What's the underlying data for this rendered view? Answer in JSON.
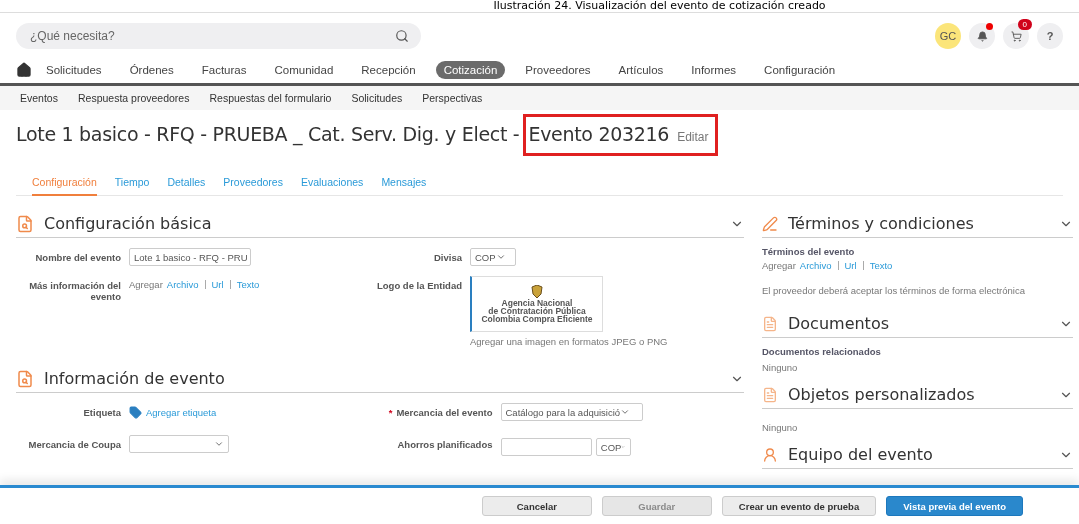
{
  "caption": "Ilustración 24. Visualización del evento de cotización creado",
  "search": {
    "placeholder": "¿Qué necesita?"
  },
  "header": {
    "avatar": "GC",
    "notifications_unread": true,
    "cart_count": "0",
    "help": "?"
  },
  "nav": [
    {
      "label": "Solicitudes",
      "selected": false
    },
    {
      "label": "Órdenes",
      "selected": false
    },
    {
      "label": "Facturas",
      "selected": false
    },
    {
      "label": "Comunidad",
      "selected": false
    },
    {
      "label": "Recepción",
      "selected": false
    },
    {
      "label": "Cotización",
      "selected": true
    },
    {
      "label": "Proveedores",
      "selected": false
    },
    {
      "label": "Artículos",
      "selected": false
    },
    {
      "label": "Informes",
      "selected": false
    },
    {
      "label": "Configuración",
      "selected": false
    }
  ],
  "subnav": [
    "Eventos",
    "Respuesta proveedores",
    "Respuestas del formulario",
    "Solicitudes",
    "Perspectivas"
  ],
  "title": {
    "text": "Lote 1 basico - RFQ - PRUEBA _ Cat. Serv. Dig. y Elect -",
    "highlighted": "Evento 203216",
    "action": "Editar"
  },
  "tabs": [
    {
      "label": "Configuración",
      "selected": true
    },
    {
      "label": "Tiempo",
      "selected": false
    },
    {
      "label": "Detalles",
      "selected": false
    },
    {
      "label": "Proveedores",
      "selected": false
    },
    {
      "label": "Evaluaciones",
      "selected": false
    },
    {
      "label": "Mensajes",
      "selected": false
    }
  ],
  "basic_config": {
    "title": "Configuración básica",
    "event_name_label": "Nombre del evento",
    "event_name_value": "Lote 1 basico - RFQ - PRU",
    "more_info_label": "Más información del evento",
    "add": "Agregar",
    "links": [
      "Archivo",
      "Url",
      "Texto"
    ],
    "currency_label": "Divisa",
    "currency": "COP",
    "logo_label": "Logo de la Entidad",
    "logo_lines": [
      "Agencia Nacional",
      "de Contratación Pública",
      "Colombia Compra Eficiente"
    ],
    "logo_hint": "Agregar una imagen en formatos JPEG o PNG"
  },
  "event_info": {
    "title": "Información de evento",
    "tag_label": "Etiqueta",
    "tag_action": "Agregar etiqueta",
    "commodity_label": "Mercancia del evento",
    "required_mark": "*",
    "commodity_value": "Catálogo para la adquisició",
    "coupa_label": "Mercancia de Coupa",
    "savings_label": "Ahorros planificados",
    "savings_currency": "COP"
  },
  "terms": {
    "title": "Términos y condiciones",
    "label": "Términos del evento",
    "add": "Agregar",
    "links": [
      "Archivo",
      "Url",
      "Texto"
    ],
    "note": "El proveedor deberá aceptar los términos de forma electrónica"
  },
  "documents": {
    "title": "Documentos",
    "label": "Documentos relacionados",
    "value": "Ninguno"
  },
  "custom_objects": {
    "title": "Objetos personalizados",
    "value": "Ninguno"
  },
  "team": {
    "title": "Equipo del evento"
  },
  "footer_buttons": [
    {
      "label": "Cancelar",
      "kind": "secondary"
    },
    {
      "label": "Guardar",
      "kind": "disabled"
    },
    {
      "label": "Crear un evento de prueba",
      "kind": "secondary"
    },
    {
      "label": "Vista previa del evento",
      "kind": "primary"
    }
  ]
}
